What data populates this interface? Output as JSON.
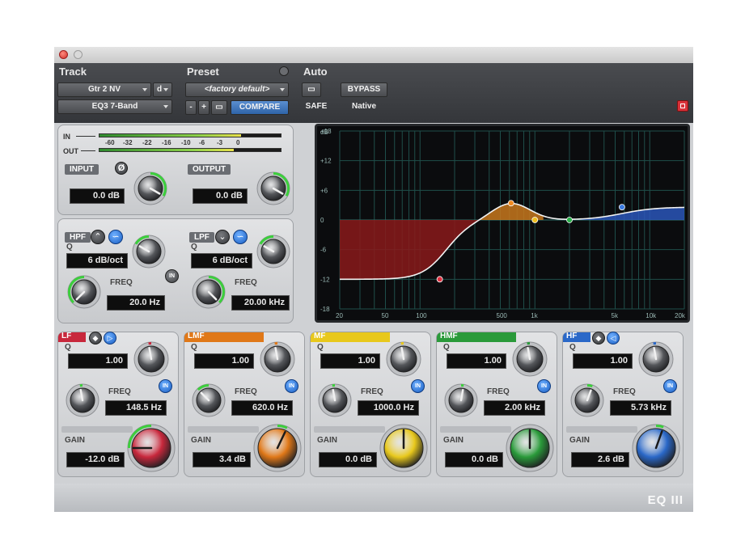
{
  "header": {
    "track_label": "Track",
    "preset_label": "Preset",
    "auto_label": "Auto",
    "track_name": "Gtr 2 NV",
    "track_suffix": "d",
    "plugin_name": "EQ3 7-Band",
    "preset_name": "<factory default>",
    "preset_minus": "-",
    "preset_plus": "+",
    "compare_label": "COMPARE",
    "bypass_label": "BYPASS",
    "safe_label": "SAFE",
    "native_label": "Native"
  },
  "meters": {
    "in_label": "IN",
    "out_label": "OUT",
    "scale": [
      "-60",
      "-32",
      "-22",
      "-16",
      "-10",
      "-6",
      "-3",
      "0"
    ],
    "in_level": 0.78,
    "out_level": 0.74
  },
  "io": {
    "input_label": "INPUT",
    "input_value": "0.0 dB",
    "phase_symbol": "Ø",
    "output_label": "OUTPUT",
    "output_value": "0.0 dB"
  },
  "filters": {
    "hpf": {
      "label": "HPF",
      "q_label": "Q",
      "q_value": "6 dB/oct",
      "freq_label": "FREQ",
      "freq_value": "20.0 Hz",
      "in_label": "IN"
    },
    "lpf": {
      "label": "LPF",
      "q_label": "Q",
      "q_value": "6 dB/oct",
      "freq_label": "FREQ",
      "freq_value": "20.00 kHz",
      "in_label": "IN"
    }
  },
  "graph": {
    "db_labels": [
      "dB",
      "+18",
      "+12",
      "+6",
      "0",
      "-6",
      "-12",
      "-18"
    ],
    "freq_labels": [
      "20",
      "50",
      "100",
      "500",
      "1k",
      "5k",
      "10k",
      "20k"
    ]
  },
  "bands": [
    {
      "name": "LF",
      "q_label": "Q",
      "q_value": "1.00",
      "freq_label": "FREQ",
      "freq_value": "148.5 Hz",
      "gain_label": "GAIN",
      "gain_value": "-12.0 dB",
      "in_label": "IN",
      "color": "#c8283c"
    },
    {
      "name": "LMF",
      "q_label": "Q",
      "q_value": "1.00",
      "freq_label": "FREQ",
      "freq_value": "620.0 Hz",
      "gain_label": "GAIN",
      "gain_value": "3.4 dB",
      "in_label": "IN",
      "color": "#e07818"
    },
    {
      "name": "MF",
      "q_label": "Q",
      "q_value": "1.00",
      "freq_label": "FREQ",
      "freq_value": "1000.0 Hz",
      "gain_label": "GAIN",
      "gain_value": "0.0 dB",
      "in_label": "IN",
      "color": "#e8c81c"
    },
    {
      "name": "HMF",
      "q_label": "Q",
      "q_value": "1.00",
      "freq_label": "FREQ",
      "freq_value": "2.00 kHz",
      "gain_label": "GAIN",
      "gain_value": "0.0 dB",
      "in_label": "IN",
      "color": "#2a9a3a"
    },
    {
      "name": "HF",
      "q_label": "Q",
      "q_value": "1.00",
      "freq_label": "FREQ",
      "freq_value": "5.73 kHz",
      "gain_label": "GAIN",
      "gain_value": "2.6 dB",
      "in_label": "IN",
      "color": "#2a68c8"
    }
  ],
  "footer": {
    "logo": "EQ III"
  },
  "icons": {
    "hpf_shape": "highpass-shape-icon",
    "lpf_shape": "lowpass-shape-icon",
    "lf_shape": "low-shelf-icon",
    "hf_shape": "high-shelf-icon"
  }
}
